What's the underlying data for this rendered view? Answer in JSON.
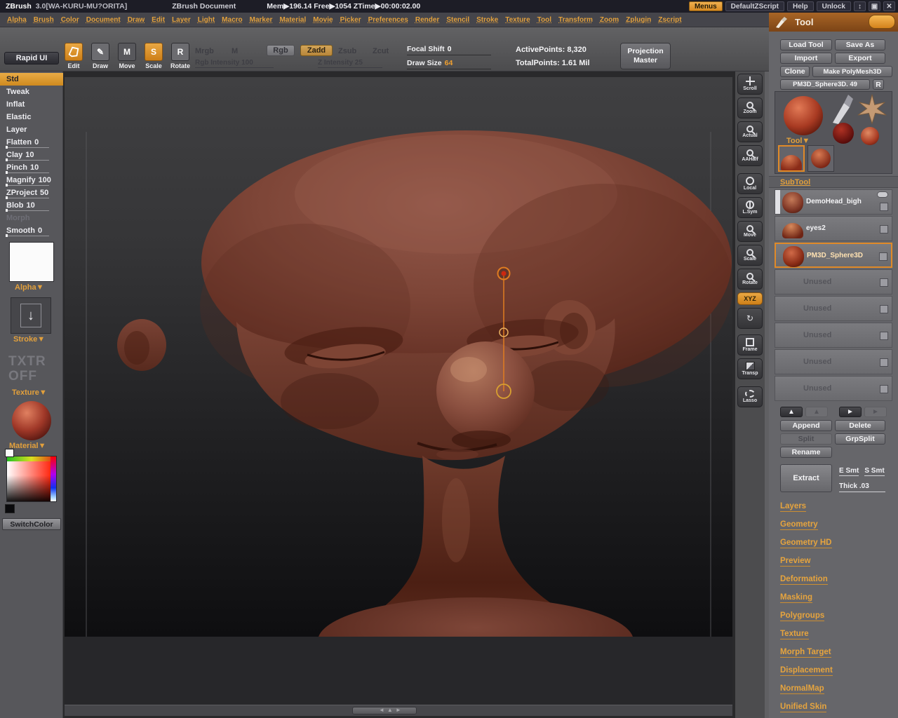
{
  "titlebar": {
    "app_name": "ZBrush",
    "version": "3.0[WA-KURU-MU?ORITA]",
    "document_name": "ZBrush Document",
    "stats": "Mem▶196.14   Free▶1054   ZTime▶00:00:02.00",
    "menus_button": "Menus",
    "defaultzscript_button": "DefaultZScript",
    "help_button": "Help",
    "unlock_button": "Unlock",
    "window_icons": {
      "updown": "↕",
      "grid": "▣",
      "close": "✕"
    }
  },
  "menubar": {
    "items": [
      "Alpha",
      "Brush",
      "Color",
      "Document",
      "Draw",
      "Edit",
      "Layer",
      "Light",
      "Macro",
      "Marker",
      "Material",
      "Movie",
      "Picker",
      "Preferences",
      "Render",
      "Stencil",
      "Stroke",
      "Texture",
      "Tool",
      "Transform",
      "Zoom",
      "Zplugin",
      "Zscript"
    ]
  },
  "toolbar": {
    "rapid_ui": "Rapid UI",
    "edit_label": "Edit",
    "draw_label": "Draw",
    "move_label": "Move",
    "scale_label": "Scale",
    "rotate_label": "Rotate",
    "draw_glyph": "✎",
    "move_glyph": "M",
    "scale_glyph": "S",
    "rotate_glyph": "R",
    "mrgb": "Mrgb",
    "m": "M",
    "rgb": "Rgb",
    "zadd": "Zadd",
    "zsub": "Zsub",
    "zcut": "Zcut",
    "rgb_intensity": "Rgb Intensity 100",
    "z_intensity": "Z Intensity 25",
    "focal_shift_label": "Focal Shift",
    "focal_shift_value": "0",
    "draw_size_label": "Draw Size",
    "draw_size_value": "64",
    "active_points": "ActivePoints: 8,320",
    "total_points": "TotalPoints: 1.61 Mil",
    "projection_master": "Projection Master"
  },
  "left_panel": {
    "brushes": [
      {
        "label": "Std",
        "value": ""
      },
      {
        "label": "Tweak",
        "value": ""
      },
      {
        "label": "Inflat",
        "value": ""
      },
      {
        "label": "Elastic",
        "value": ""
      },
      {
        "label": "Layer",
        "value": ""
      },
      {
        "label": "Flatten",
        "value": "0"
      },
      {
        "label": "Clay",
        "value": "10"
      },
      {
        "label": "Pinch",
        "value": "10"
      },
      {
        "label": "Magnify",
        "value": "100"
      },
      {
        "label": "ZProject",
        "value": "50"
      },
      {
        "label": "Blob",
        "value": "10"
      },
      {
        "label": "Morph",
        "value": ""
      },
      {
        "label": "Smooth",
        "value": "0"
      }
    ],
    "alpha_label": "Alpha▼",
    "stroke_label": "Stroke▼",
    "txtr_line1": "TXTR",
    "txtr_line2": "OFF",
    "texture_label": "Texture▼",
    "material_label": "Material▼",
    "switch_color": "SwitchColor"
  },
  "shelf": {
    "buttons": [
      {
        "label": "Scroll",
        "icon": "pan-icon"
      },
      {
        "label": "Zoom",
        "icon": "magnifier-icon"
      },
      {
        "label": "Actual",
        "icon": "magnifier-icon"
      },
      {
        "label": "AAHalf",
        "icon": "magnifier-icon"
      },
      {
        "label": "Local",
        "icon": "circle-icon"
      },
      {
        "label": "L.Sym",
        "icon": "symmetry-icon"
      },
      {
        "label": "Move",
        "icon": "magnifier-icon"
      },
      {
        "label": "Scale",
        "icon": "magnifier-icon"
      },
      {
        "label": "Rotate",
        "icon": "magnifier-icon"
      },
      {
        "label": "XYZ",
        "icon": ""
      },
      {
        "label": "",
        "icon": "rotate-arrows-icon",
        "glyph": "↻"
      },
      {
        "label": "Frame",
        "icon": "frame-icon"
      },
      {
        "label": "Transp",
        "icon": "transparency-icon"
      },
      {
        "label": "Lasso",
        "icon": "lasso-icon"
      }
    ]
  },
  "canvas": {
    "hscroll_arrows": "◄▲►"
  },
  "tool_palette": {
    "title": "Tool",
    "load_tool": "Load Tool",
    "save_as": "Save As",
    "import": "Import",
    "export": "Export",
    "clone": "Clone",
    "make_polymesh3d": "Make PolyMesh3D",
    "current_tool": "PM3D_Sphere3D. 49",
    "r_button": "R",
    "tool_dropdown_label": "Tool▼",
    "subtool": {
      "header": "SubTool",
      "items": [
        {
          "name": "DemoHead_bigh"
        },
        {
          "name": "eyes2"
        },
        {
          "name": "PM3D_Sphere3D"
        },
        {
          "name": "Unused"
        },
        {
          "name": "Unused"
        },
        {
          "name": "Unused"
        },
        {
          "name": "Unused"
        },
        {
          "name": "Unused"
        }
      ],
      "arrow_up": "▲",
      "arrow_right": "►",
      "append": "Append",
      "delete": "Delete",
      "split": "Split",
      "grpsplit": "GrpSplit",
      "rename": "Rename",
      "extract": "Extract",
      "e_smt": "E Smt",
      "s_smt": "S Smt",
      "thick": "Thick .03"
    },
    "sections": [
      "Layers",
      "Geometry",
      "Geometry HD",
      "Preview",
      "Deformation",
      "Masking",
      "Polygroups",
      "Texture",
      "Morph Target",
      "Displacement",
      "NormalMap",
      "Unified Skin"
    ]
  },
  "colors": {
    "accent": "#e2a03c",
    "selection": "#e08a28",
    "clay": "#7d4537"
  }
}
